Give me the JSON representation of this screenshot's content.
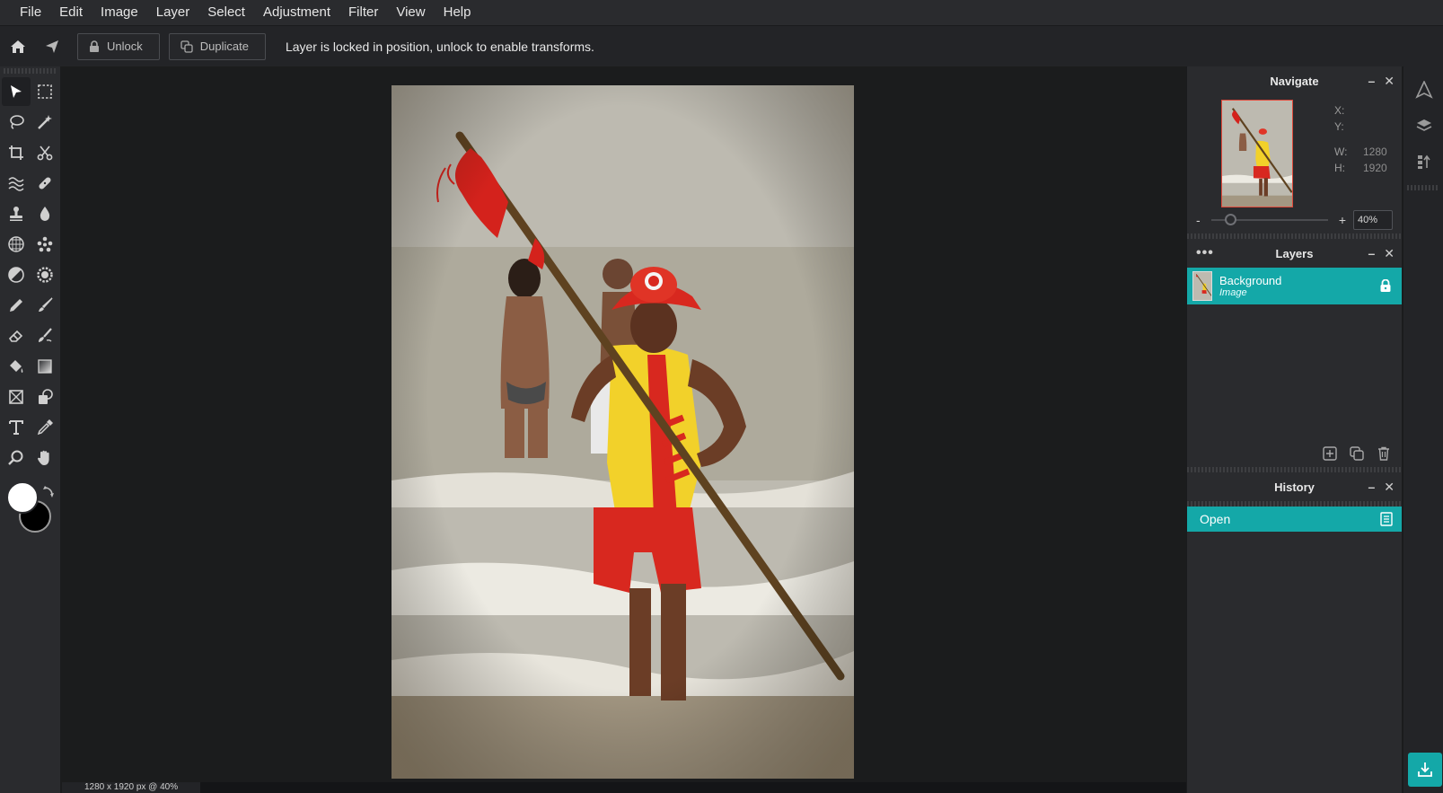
{
  "menu": [
    "File",
    "Edit",
    "Image",
    "Layer",
    "Select",
    "Adjustment",
    "Filter",
    "View",
    "Help"
  ],
  "options": {
    "unlock_label": "Unlock",
    "duplicate_label": "Duplicate",
    "message": "Layer is locked in position, unlock to enable transforms."
  },
  "tools": [
    "move",
    "marquee",
    "lasso",
    "magic-wand",
    "crop",
    "scissors",
    "liquify",
    "healing",
    "stamp",
    "blur",
    "sphere",
    "spot",
    "dodge",
    "sharpen",
    "pen",
    "brush",
    "eraser",
    "smudge",
    "fill",
    "gradient",
    "frame",
    "shape",
    "text",
    "eyedropper",
    "zoom",
    "hand"
  ],
  "colors": {
    "foreground": "#ffffff",
    "background": "#000000",
    "accent": "#14a8a8"
  },
  "canvas": {
    "status": "1280 x 1920 px @ 40%"
  },
  "navigate": {
    "title": "Navigate",
    "x_label": "X:",
    "x_value": "",
    "y_label": "Y:",
    "y_value": "",
    "w_label": "W:",
    "w_value": "1280",
    "h_label": "H:",
    "h_value": "1920",
    "zoom_minus": "-",
    "zoom_plus": "+",
    "zoom_value": "40%",
    "zoom_fraction": 0.12
  },
  "layers": {
    "title": "Layers",
    "items": [
      {
        "name": "Background",
        "type": "Image",
        "locked": true
      }
    ]
  },
  "history": {
    "title": "History",
    "items": [
      {
        "label": "Open"
      }
    ]
  }
}
